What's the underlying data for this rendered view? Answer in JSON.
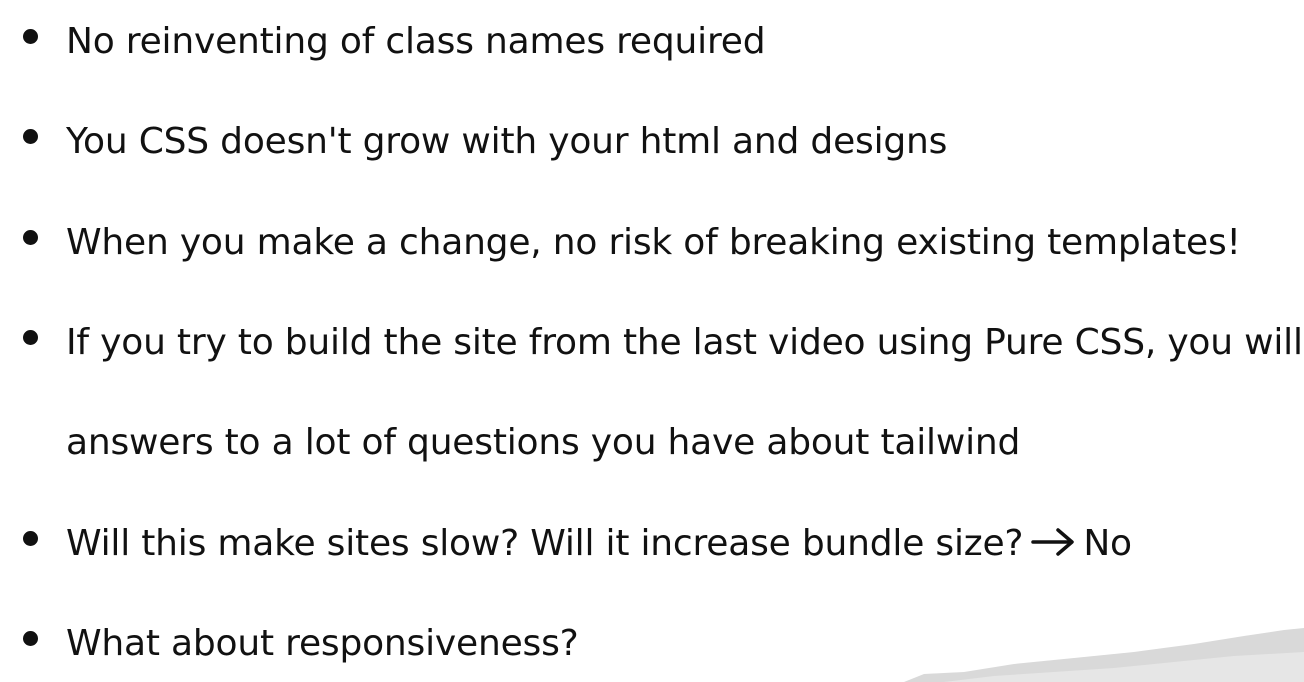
{
  "bullets": [
    {
      "lines": [
        "No reinventing of class names required"
      ]
    },
    {
      "lines": [
        "You CSS doesn't grow with your html and designs"
      ]
    },
    {
      "lines": [
        "When you make a change, no risk of breaking existing templates!"
      ]
    },
    {
      "lines": [
        "If you try to build the site from the last video using Pure CSS, you will get",
        "answers to a lot of questions you have about tailwind"
      ]
    },
    {
      "lines": [
        "Will this make sites slow? Will it increase bundle size?"
      ],
      "after_arrow": "No"
    },
    {
      "lines": [
        "What about responsiveness?"
      ]
    }
  ],
  "icons": {
    "arrow": "right-arrow-icon"
  },
  "colors": {
    "text": "#111111",
    "background": "#ffffff",
    "paper_scrap": "#d9d9d9"
  }
}
